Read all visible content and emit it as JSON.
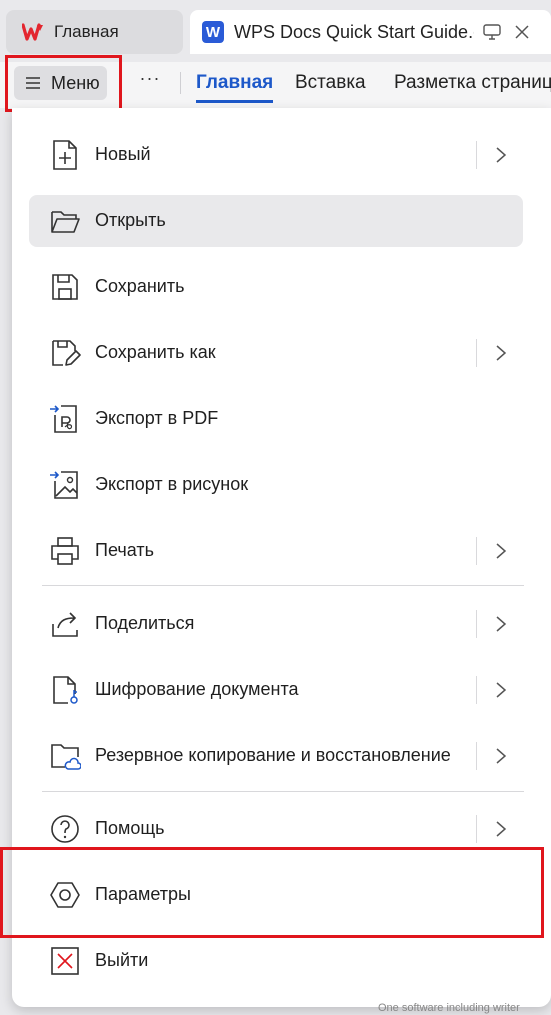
{
  "tabs": {
    "home_label": "Главная",
    "doc_title": "WPS Docs Quick Start Guide.do",
    "doc_icon_letter": "W"
  },
  "ribbon": {
    "menu_label": "Меню",
    "more_label": "···",
    "tabs": [
      "Главная",
      "Вставка",
      "Разметка страниц"
    ]
  },
  "menu": {
    "items": [
      {
        "label": "Новый",
        "icon": "new-doc-icon",
        "submenu": true
      },
      {
        "label": "Открыть",
        "icon": "folder-open-icon",
        "submenu": false
      },
      {
        "label": "Сохранить",
        "icon": "save-icon",
        "submenu": false
      },
      {
        "label": "Сохранить как",
        "icon": "save-as-icon",
        "submenu": true
      },
      {
        "label": "Экспорт в PDF",
        "icon": "export-pdf-icon",
        "submenu": false
      },
      {
        "label": "Экспорт в рисунок",
        "icon": "export-image-icon",
        "submenu": false
      },
      {
        "label": "Печать",
        "icon": "printer-icon",
        "submenu": true
      },
      {
        "label": "Поделиться",
        "icon": "share-icon",
        "submenu": true
      },
      {
        "label": "Шифрование документа",
        "icon": "encrypt-doc-icon",
        "submenu": true
      },
      {
        "label": "Резервное копирование и восстановление",
        "icon": "backup-icon",
        "submenu": true
      },
      {
        "label": "Помощь",
        "icon": "help-icon",
        "submenu": true
      },
      {
        "label": "Параметры",
        "icon": "settings-icon",
        "submenu": false
      },
      {
        "label": "Выйти",
        "icon": "exit-icon",
        "submenu": false
      }
    ]
  },
  "background_text": "One software including writer",
  "colors": {
    "accent": "#1d58c9",
    "highlight": "#e0161d",
    "brand": "#e3262f"
  }
}
